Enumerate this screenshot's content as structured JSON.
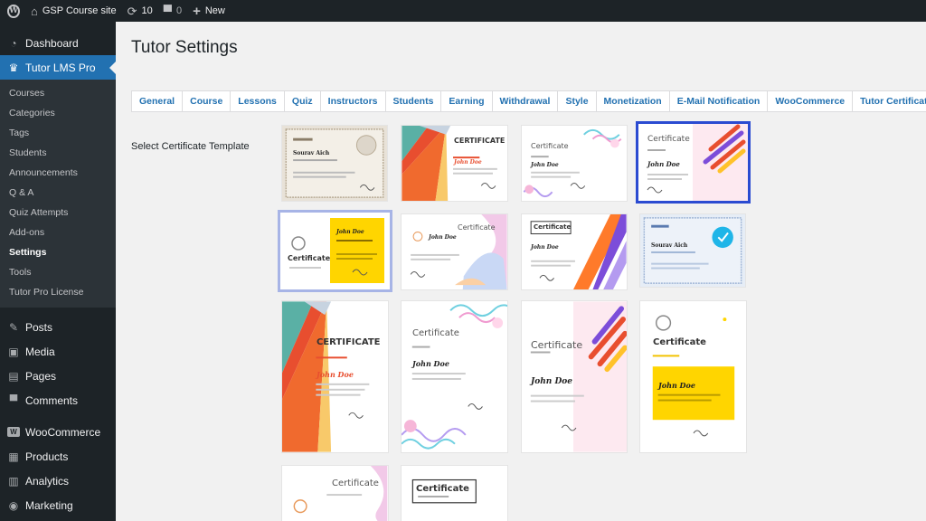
{
  "adminbar": {
    "site_name": "GSP Course site",
    "updates_count": "10",
    "comments_count": "0",
    "new_label": "New"
  },
  "sidebar": {
    "dashboard": "Dashboard",
    "tutor_lms": "Tutor LMS Pro",
    "submenu": [
      "Courses",
      "Categories",
      "Tags",
      "Students",
      "Announcements",
      "Q & A",
      "Quiz Attempts",
      "Add-ons",
      "Settings",
      "Tools",
      "Tutor Pro License"
    ],
    "posts": "Posts",
    "media": "Media",
    "pages": "Pages",
    "comments": "Comments",
    "woocommerce": "WooCommerce",
    "products": "Products",
    "analytics": "Analytics",
    "marketing": "Marketing"
  },
  "main": {
    "title": "Tutor Settings",
    "tabs": [
      "General",
      "Course",
      "Lessons",
      "Quiz",
      "Instructors",
      "Students",
      "Earning",
      "Withdrawal",
      "Style",
      "Monetization",
      "E-Mail Notification",
      "WooCommerce",
      "Tutor Certificate"
    ],
    "field_label": "Select Certificate Template"
  },
  "certificates": {
    "title_caps": "CERTIFICATE",
    "title": "Certificate",
    "name_doe": "John Doe",
    "name_aich": "Sourav Aich"
  },
  "colors": {
    "wp_blue": "#2271b1",
    "admin_dark": "#1d2327",
    "selected_border": "#2b4bd1",
    "cert_yellow": "#ffd500"
  }
}
